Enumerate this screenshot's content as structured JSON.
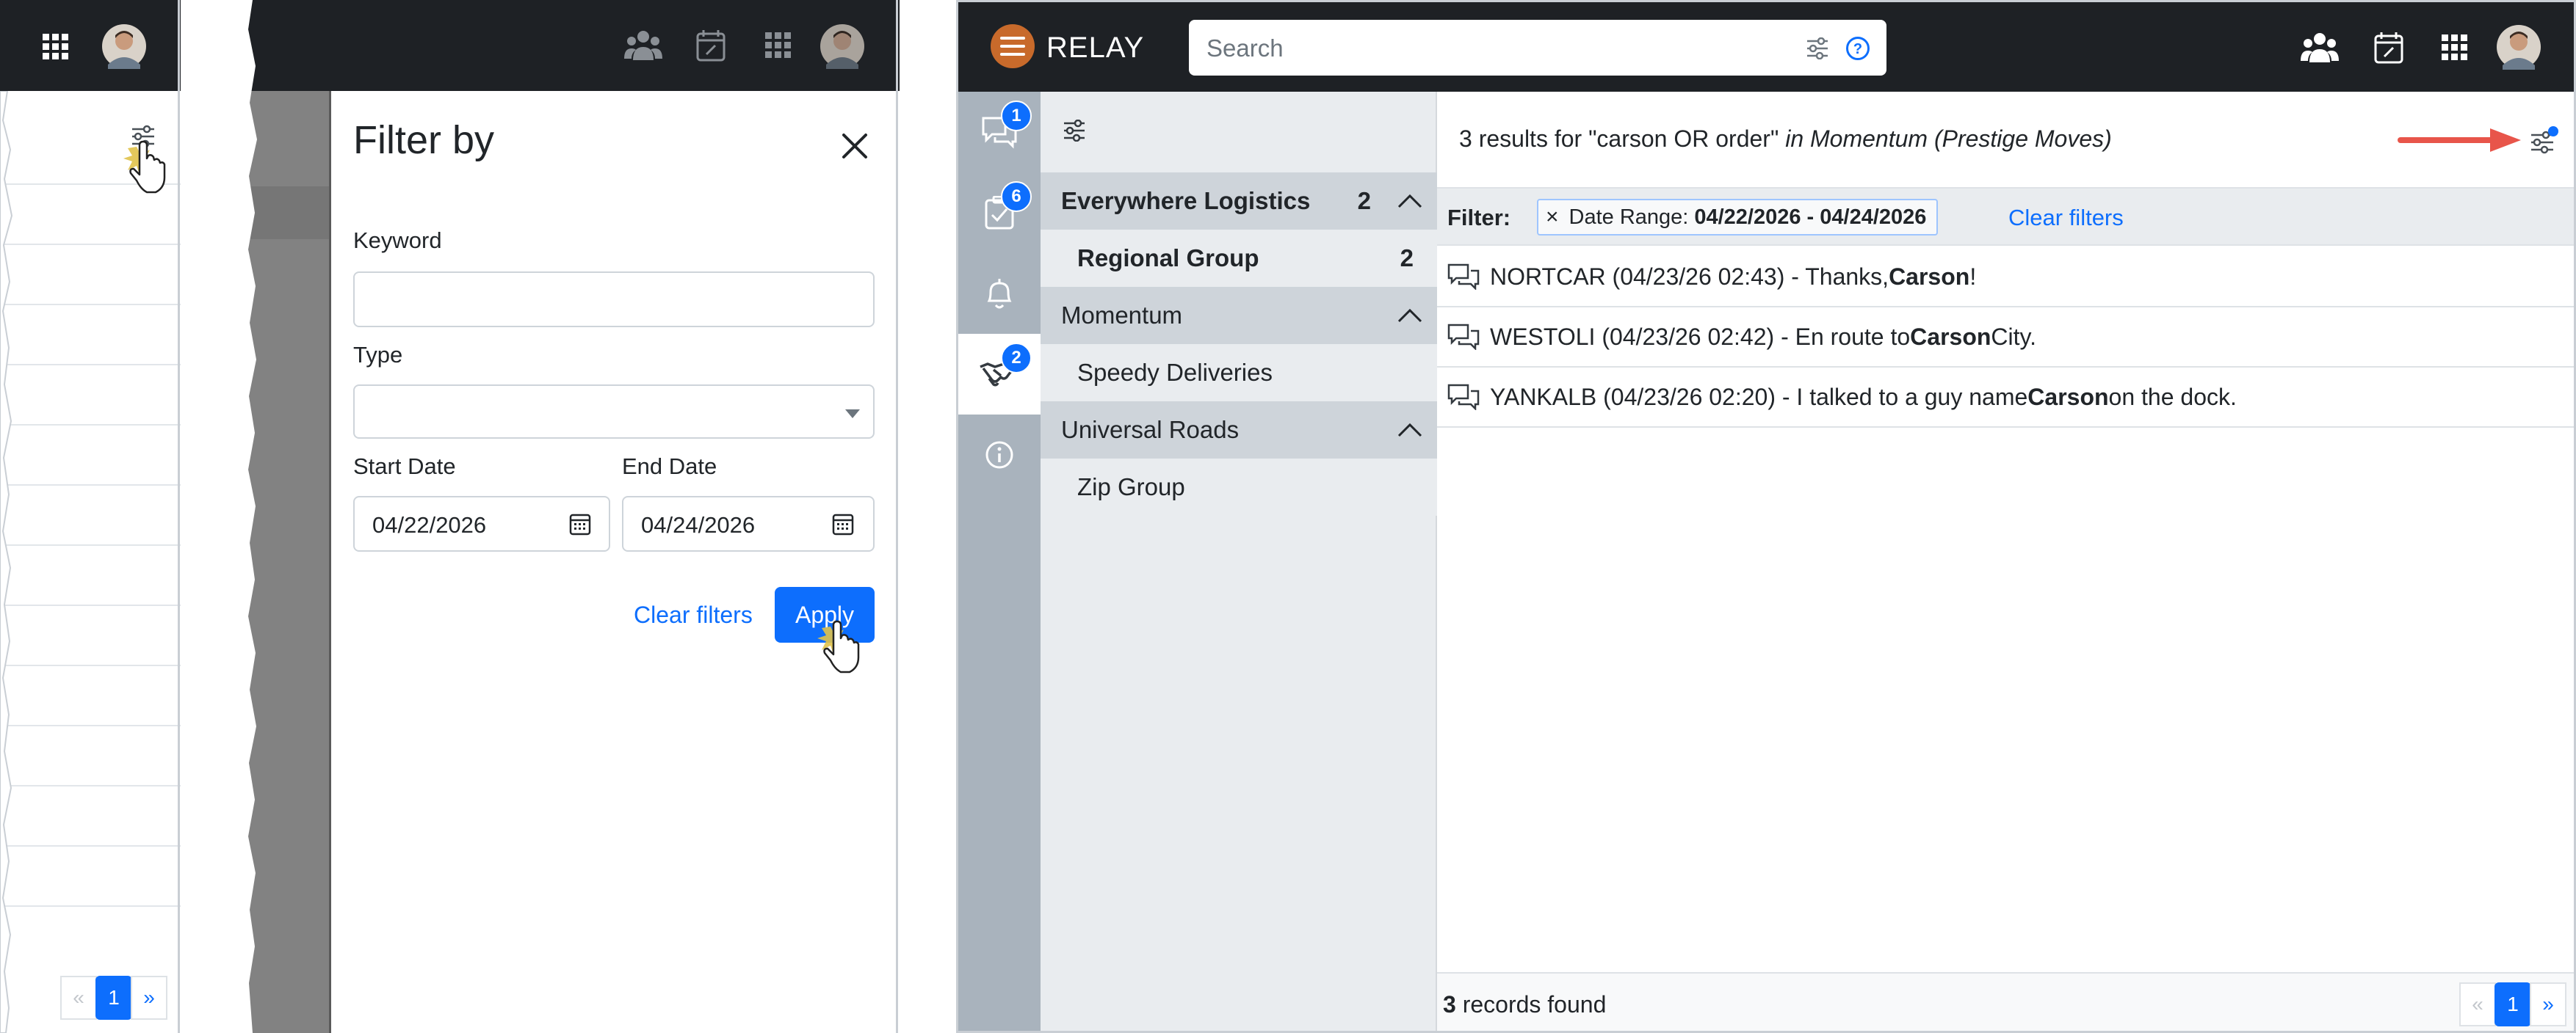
{
  "panel1": {
    "pagination": {
      "prev": "«",
      "page": "1",
      "next": "»"
    }
  },
  "panel2": {
    "drawer": {
      "title": "Filter by",
      "keyword_label": "Keyword",
      "keyword_value": "",
      "type_label": "Type",
      "type_value": "",
      "start_label": "Start Date",
      "start_value": "04/22/2026",
      "end_label": "End Date",
      "end_value": "04/24/2026",
      "clear_label": "Clear filters",
      "apply_label": "Apply"
    }
  },
  "panel3": {
    "brand": "RELAY",
    "search_placeholder": "Search",
    "rail_badges": {
      "messages": "1",
      "tasks": "6",
      "deals": "2"
    },
    "tree": [
      {
        "label": "Everywhere Logistics",
        "count": "2",
        "level": "group",
        "expanded": true
      },
      {
        "label": "Regional Group",
        "count": "2",
        "level": "child",
        "bold": true
      },
      {
        "label": "Momentum",
        "count": "",
        "level": "group",
        "expanded": true
      },
      {
        "label": "Speedy Deliveries",
        "count": "",
        "level": "child",
        "bold": false
      },
      {
        "label": "Universal Roads",
        "count": "",
        "level": "group",
        "expanded": true
      },
      {
        "label": "Zip Group",
        "count": "",
        "level": "child",
        "bold": false
      }
    ],
    "results_header": {
      "prefix": "3 results for \"carson OR order\"",
      "scope": "in Momentum (Prestige Moves)"
    },
    "filter": {
      "label": "Filter:",
      "chip_remove": "×",
      "chip_key": "Date Range:",
      "chip_value": "04/22/2026 - 04/24/2026",
      "clear_label": "Clear filters"
    },
    "results": [
      {
        "pre": "NORTCAR (04/23/26 02:43) - Thanks, ",
        "hit": "Carson",
        "post": "!"
      },
      {
        "pre": "WESTOLI (04/23/26 02:42) - En route to ",
        "hit": "Carson",
        "post": " City."
      },
      {
        "pre": "YANKALB (04/23/26 02:20) - I talked to a guy name ",
        "hit": "Carson",
        "post": " on the dock."
      }
    ],
    "footer": {
      "count": "3",
      "suffix": " records found"
    },
    "pagination": {
      "prev": "«",
      "page": "1",
      "next": "»"
    }
  },
  "colors": {
    "topbar": "#1e2125",
    "primary": "#0d6efd",
    "brand_logo": "#c86a2b",
    "annotation_arrow": "#e8554a",
    "cursor_burst": "#e0c24a"
  },
  "icons": [
    "grid-icon",
    "avatar",
    "team-icon",
    "calendar-icon",
    "filter-sliders-icon",
    "close-icon",
    "calendar-icon",
    "chevron-down-icon",
    "help-icon",
    "chat-icon",
    "checklist-icon",
    "bell-icon",
    "handshake-icon",
    "info-icon",
    "chevron-up-icon",
    "hand-cursor-icon",
    "arrow-annotation"
  ]
}
